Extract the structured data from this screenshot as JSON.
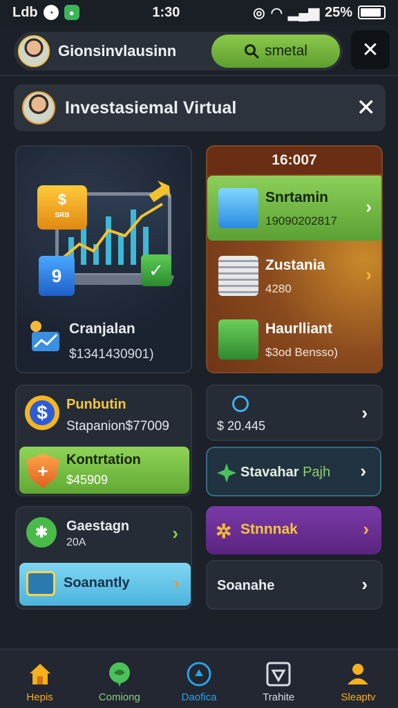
{
  "status_bar": {
    "carrier": "Ldb",
    "time": "1:30",
    "battery": "25%"
  },
  "header": {
    "title": "Gionsinvlausinn",
    "search_label": "smetal"
  },
  "banner": {
    "title": "Investasiemal Virtual"
  },
  "hero_card": {
    "label": "Cranjalan",
    "value": "$1341430901)",
    "tile_text": "$",
    "tile_sub": "SRB",
    "cube_text": "9"
  },
  "panel": {
    "header": "16:007",
    "rows": [
      {
        "title": "Snrtamin",
        "sub": "19090202817",
        "icon": "crystal-box-icon",
        "highlight": true
      },
      {
        "title": "Zustania",
        "sub": "4280",
        "icon": "document-stack-icon",
        "highlight": false
      },
      {
        "title": "Haurlliant",
        "sub": "$3od Bensso)",
        "icon": "green-box-icon",
        "highlight": false
      }
    ]
  },
  "mid_left": {
    "title": "Punbutin",
    "sub": "Stapanion$77009",
    "button_title": "Kontrtation",
    "button_value": "$45909"
  },
  "mid_right": {
    "value": "$ 20.445",
    "link_text": "Stavahar",
    "link_suffix": "Pajh"
  },
  "bottom_left": {
    "title": "Gaestagn",
    "sub": "20A",
    "button_label": "Soanantly"
  },
  "bottom_right": {
    "purple_label": "Stnnnak",
    "plain_label": "Soanahe"
  },
  "nav": [
    {
      "label": "Hepis",
      "icon": "home-icon",
      "color": "#f4b01e"
    },
    {
      "label": "Comiong",
      "icon": "chat-icon",
      "color": "#4cc05a"
    },
    {
      "label": "Daofica",
      "icon": "location-icon",
      "color": "#2aa2e8"
    },
    {
      "label": "Trahite",
      "icon": "heart-frame-icon",
      "color": "#d8dde4"
    },
    {
      "label": "Sleaptv",
      "icon": "user-icon",
      "color": "#f4b01e"
    }
  ],
  "colors": {
    "accent_green": "#8cc84b",
    "accent_gold": "#f4b93a",
    "background": "#1c2028"
  }
}
